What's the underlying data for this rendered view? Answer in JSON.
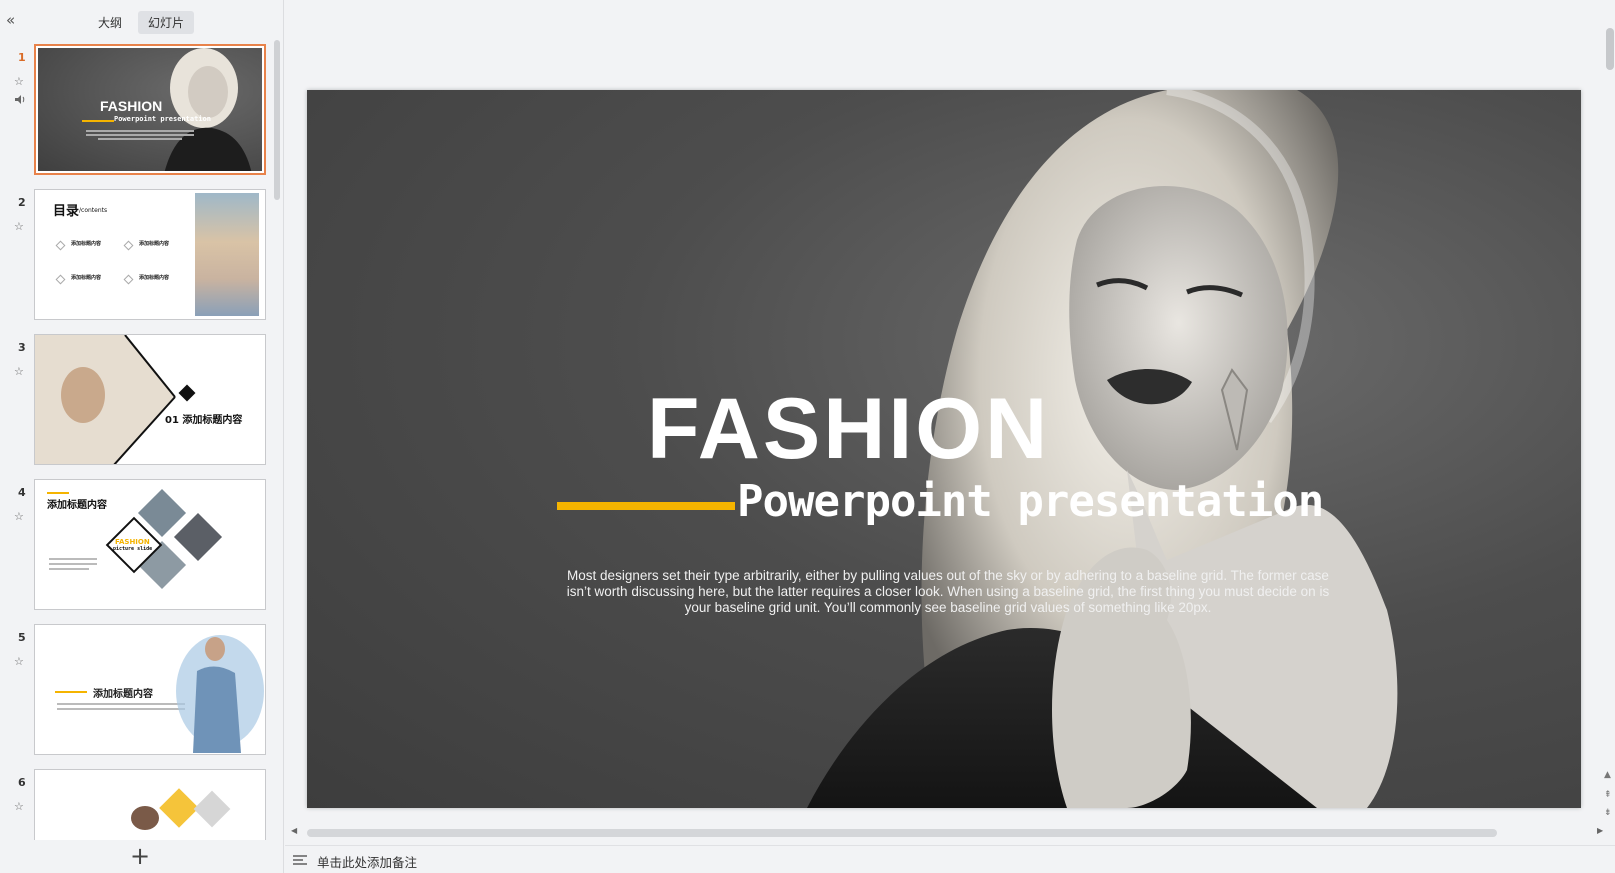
{
  "sidebar": {
    "tabs": [
      {
        "label": "大纲",
        "active": false
      },
      {
        "label": "幻灯片",
        "active": true
      }
    ],
    "slides": [
      {
        "number": "1",
        "title": "FASHION",
        "subtitle": "Powerpoint presentation",
        "selected": true
      },
      {
        "number": "2",
        "title": "目录",
        "title_suffix": "/contents",
        "items": [
          "添加标题内容",
          "添加标题内容",
          "添加标题内容",
          "添加标题内容"
        ]
      },
      {
        "number": "3",
        "title": "01 添加标题内容"
      },
      {
        "number": "4",
        "title": "添加标题内容",
        "badge": "FASHION",
        "badge_sub": "picture slide"
      },
      {
        "number": "5",
        "title": "添加标题内容"
      },
      {
        "number": "6"
      }
    ],
    "star_icon": "☆",
    "sound_icon": "speaker-icon",
    "add_label": "+"
  },
  "slide": {
    "title": "FASHION",
    "subtitle": "Powerpoint presentation",
    "body": "Most designers set their type arbitrarily, either by pulling values out of the sky or by adhering to a baseline grid. The former case isn’t worth discussing here, but the latter requires a closer look. When using a baseline grid, the first thing you must decide on is your baseline grid unit. You’ll commonly see baseline grid values of something like 20px.",
    "accent_color": "#f5b400"
  },
  "notes": {
    "placeholder": "单击此处添加备注"
  }
}
